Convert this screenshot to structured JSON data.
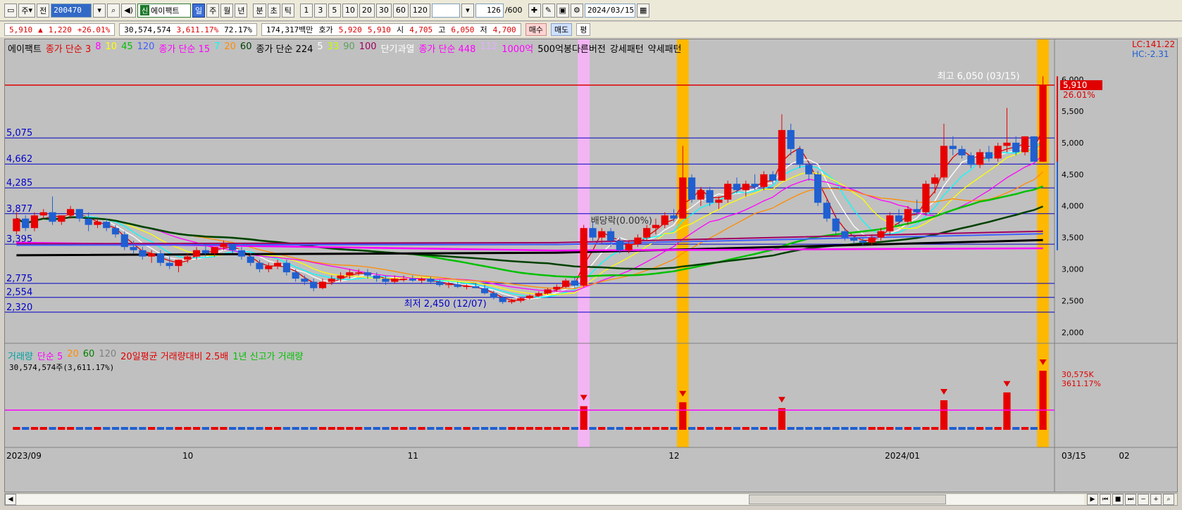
{
  "toolbar": {
    "period_label": "주",
    "prev_label": "전",
    "stock_code": "200470",
    "stock_badge": "신",
    "stock_name": "에이팩트",
    "periods": [
      "일",
      "주",
      "월",
      "년",
      "분",
      "초",
      "틱"
    ],
    "numbers": [
      "1",
      "3",
      "5",
      "10",
      "20",
      "30",
      "60",
      "120"
    ],
    "count": "126",
    "count_total": "/600",
    "date": "2024/03/15"
  },
  "price_info": {
    "price": "5,910",
    "change_arrow": "▲",
    "change": "1,220",
    "change_pct": "+26.01%",
    "volume": "30,574,574",
    "volume_pct": "3,611.17%",
    "turnover_pct": "72.17%",
    "amount": "174,317백만",
    "quote_label": "호가",
    "ask": "5,920",
    "bid": "5,910",
    "open_label": "시",
    "open": "4,705",
    "high_label": "고",
    "high": "6,050",
    "low_label": "저",
    "low": "4,700",
    "buy_label": "매수",
    "sell_label": "매도",
    "avg_label": "평"
  },
  "legend_price": [
    {
      "text": "에이팩트",
      "color": "#000000"
    },
    {
      "text": "종가 단순 3",
      "color": "#e00000"
    },
    {
      "text": "8",
      "color": "#ff00ff"
    },
    {
      "text": "10",
      "color": "#ffff00"
    },
    {
      "text": "45",
      "color": "#00c000"
    },
    {
      "text": "120",
      "color": "#4060ff"
    },
    {
      "text": "종가 단순 15",
      "color": "#ff00ff"
    },
    {
      "text": "7",
      "color": "#00ffff"
    },
    {
      "text": "20",
      "color": "#ff8c00"
    },
    {
      "text": "60",
      "color": "#004000"
    },
    {
      "text": "종가 단순 224",
      "color": "#000000"
    },
    {
      "text": "5",
      "color": "#ffffff"
    },
    {
      "text": "33",
      "color": "#c0ff00"
    },
    {
      "text": "90",
      "color": "#60a060"
    },
    {
      "text": "100",
      "color": "#a00060"
    },
    {
      "text": "단기과열",
      "color": "#ffffff"
    },
    {
      "text": "종가 단순 448",
      "color": "#ff00ff"
    },
    {
      "text": "112",
      "color": "#e0b0ff"
    },
    {
      "text": "1000억",
      "color": "#ff00ff"
    },
    {
      "text": "500억봉다른버전",
      "color": "#000000"
    },
    {
      "text": "강세패턴",
      "color": "#000000"
    },
    {
      "text": "약세패턴",
      "color": "#000000"
    }
  ],
  "legend_volume": [
    {
      "text": "거래량",
      "color": "#00a0a0"
    },
    {
      "text": "단순 5",
      "color": "#ff00ff"
    },
    {
      "text": "20",
      "color": "#ff8c00"
    },
    {
      "text": "60",
      "color": "#008000"
    },
    {
      "text": "120",
      "color": "#808080"
    },
    {
      "text": "20일평균 거래량대비 2.5배",
      "color": "#e00000"
    },
    {
      "text": "1년 신고가 거래량",
      "color": "#00c000"
    }
  ],
  "volume_readout": "30,574,574주(3,611.17%)",
  "right_labels": {
    "lc": "LC:141.22",
    "hc": "HC:-2.31",
    "price_tag": "5,910",
    "pct_tag": "26.01%",
    "vol_tag": "30,575K",
    "vol_pct_tag": "3611.17%"
  },
  "annotations": {
    "high_note": "최고 6,050 (03/15)",
    "low_note": "최저 2,450 (12/07)",
    "dividend_note": "배당락(0.00%)"
  },
  "colors": {
    "up": "#e80000",
    "down": "#1f5fd0",
    "highlight_orange": "#ffb800",
    "highlight_pink": "#ffb0ff"
  },
  "chart_data": {
    "type": "candlestick",
    "y_axis_ticks": [
      6000,
      5500,
      5000,
      4500,
      4000,
      3500,
      3000,
      2500,
      2000
    ],
    "ylim": [
      1850,
      6300
    ],
    "x_axis_labels": [
      "2023/09",
      "10",
      "11",
      "12",
      "2024/01",
      "02",
      "03",
      "03/15"
    ],
    "horizontal_levels": [
      5075,
      4662,
      4285,
      3877,
      3395,
      2775,
      2554,
      2320
    ],
    "candles": [
      [
        3600,
        3900,
        3550,
        3800
      ],
      [
        3800,
        3850,
        3600,
        3650
      ],
      [
        3650,
        3900,
        3600,
        3850
      ],
      [
        3850,
        3950,
        3800,
        3900
      ],
      [
        3900,
        4150,
        3700,
        3750
      ],
      [
        3750,
        3850,
        3700,
        3850
      ],
      [
        3850,
        4000,
        3800,
        3950
      ],
      [
        3950,
        3950,
        3750,
        3800
      ],
      [
        3800,
        3900,
        3600,
        3700
      ],
      [
        3700,
        3800,
        3650,
        3750
      ],
      [
        3750,
        3800,
        3600,
        3650
      ],
      [
        3650,
        3700,
        3500,
        3550
      ],
      [
        3550,
        3600,
        3300,
        3350
      ],
      [
        3350,
        3450,
        3250,
        3300
      ],
      [
        3300,
        3350,
        3150,
        3200
      ],
      [
        3200,
        3300,
        3100,
        3250
      ],
      [
        3250,
        3300,
        3050,
        3100
      ],
      [
        3100,
        3200,
        3000,
        3050
      ],
      [
        3050,
        3150,
        2950,
        3150
      ],
      [
        3150,
        3250,
        3100,
        3200
      ],
      [
        3200,
        3350,
        3150,
        3300
      ],
      [
        3300,
        3400,
        3200,
        3250
      ],
      [
        3250,
        3350,
        3200,
        3350
      ],
      [
        3350,
        3450,
        3300,
        3400
      ],
      [
        3400,
        3400,
        3250,
        3300
      ],
      [
        3300,
        3350,
        3150,
        3200
      ],
      [
        3200,
        3250,
        3050,
        3100
      ],
      [
        3100,
        3150,
        2950,
        3000
      ],
      [
        3000,
        3100,
        2950,
        3050
      ],
      [
        3050,
        3150,
        3000,
        3100
      ],
      [
        3100,
        3150,
        2900,
        2950
      ],
      [
        2950,
        3000,
        2800,
        2850
      ],
      [
        2850,
        2900,
        2750,
        2800
      ],
      [
        2800,
        2850,
        2650,
        2700
      ],
      [
        2700,
        2850,
        2680,
        2800
      ],
      [
        2800,
        2900,
        2750,
        2850
      ],
      [
        2850,
        2950,
        2800,
        2900
      ],
      [
        2900,
        3000,
        2850,
        2950
      ],
      [
        2950,
        3000,
        2900,
        2950
      ],
      [
        2950,
        3000,
        2850,
        2900
      ],
      [
        2900,
        2950,
        2800,
        2850
      ],
      [
        2850,
        2900,
        2750,
        2800
      ],
      [
        2800,
        2900,
        2780,
        2850
      ],
      [
        2850,
        2900,
        2800,
        2850
      ],
      [
        2850,
        2900,
        2800,
        2820
      ],
      [
        2820,
        2870,
        2780,
        2850
      ],
      [
        2850,
        2880,
        2780,
        2800
      ],
      [
        2800,
        2830,
        2720,
        2750
      ],
      [
        2750,
        2800,
        2700,
        2760
      ],
      [
        2760,
        2800,
        2700,
        2720
      ],
      [
        2720,
        2760,
        2680,
        2730
      ],
      [
        2730,
        2780,
        2700,
        2700
      ],
      [
        2700,
        2750,
        2600,
        2620
      ],
      [
        2620,
        2660,
        2520,
        2550
      ],
      [
        2550,
        2580,
        2450,
        2480
      ],
      [
        2480,
        2530,
        2450,
        2500
      ],
      [
        2500,
        2560,
        2470,
        2540
      ],
      [
        2540,
        2600,
        2520,
        2580
      ],
      [
        2580,
        2650,
        2560,
        2620
      ],
      [
        2620,
        2700,
        2600,
        2680
      ],
      [
        2680,
        2760,
        2640,
        2720
      ],
      [
        2720,
        2850,
        2700,
        2820
      ],
      [
        2820,
        2880,
        2700,
        2740
      ],
      [
        2740,
        3700,
        2720,
        3650
      ],
      [
        3650,
        3750,
        3450,
        3500
      ],
      [
        3500,
        3650,
        3400,
        3600
      ],
      [
        3600,
        3650,
        3350,
        3450
      ],
      [
        3450,
        3500,
        3250,
        3300
      ],
      [
        3300,
        3450,
        3250,
        3400
      ],
      [
        3400,
        3550,
        3350,
        3500
      ],
      [
        3500,
        3700,
        3450,
        3650
      ],
      [
        3650,
        3800,
        3550,
        3700
      ],
      [
        3700,
        3900,
        3650,
        3850
      ],
      [
        3850,
        3950,
        3750,
        3800
      ],
      [
        3800,
        4950,
        3800,
        4450
      ],
      [
        4450,
        4500,
        4050,
        4100
      ],
      [
        4100,
        4300,
        4000,
        4250
      ],
      [
        4250,
        4300,
        4000,
        4050
      ],
      [
        4050,
        4150,
        3950,
        4100
      ],
      [
        4100,
        4400,
        4050,
        4350
      ],
      [
        4350,
        4450,
        4200,
        4250
      ],
      [
        4250,
        4400,
        4150,
        4350
      ],
      [
        4350,
        4500,
        4250,
        4300
      ],
      [
        4300,
        4550,
        4250,
        4500
      ],
      [
        4500,
        4550,
        4350,
        4400
      ],
      [
        4400,
        5450,
        4400,
        5200
      ],
      [
        5200,
        5300,
        4800,
        4900
      ],
      [
        4900,
        4950,
        4600,
        4650
      ],
      [
        4650,
        4700,
        4400,
        4500
      ],
      [
        4500,
        4550,
        4000,
        4050
      ],
      [
        4050,
        4100,
        3750,
        3800
      ],
      [
        3800,
        3850,
        3550,
        3600
      ],
      [
        3600,
        3650,
        3450,
        3500
      ],
      [
        3500,
        3550,
        3400,
        3450
      ],
      [
        3450,
        3500,
        3380,
        3420
      ],
      [
        3420,
        3550,
        3380,
        3500
      ],
      [
        3500,
        3650,
        3450,
        3600
      ],
      [
        3600,
        3900,
        3550,
        3850
      ],
      [
        3850,
        3950,
        3700,
        3750
      ],
      [
        3750,
        4000,
        3700,
        3950
      ],
      [
        3950,
        4100,
        3850,
        3900
      ],
      [
        3900,
        4400,
        3850,
        4350
      ],
      [
        4350,
        4500,
        4200,
        4450
      ],
      [
        4450,
        5300,
        4400,
        4950
      ],
      [
        4950,
        5100,
        4800,
        4900
      ],
      [
        4900,
        4950,
        4750,
        4800
      ],
      [
        4800,
        4850,
        4600,
        4650
      ],
      [
        4650,
        4900,
        4600,
        4850
      ],
      [
        4850,
        4950,
        4700,
        4750
      ],
      [
        4750,
        5000,
        4700,
        4950
      ],
      [
        4950,
        5550,
        4850,
        5000
      ],
      [
        5000,
        5100,
        4800,
        4850
      ],
      [
        4850,
        5100,
        4800,
        5100
      ],
      [
        5100,
        5100,
        4750,
        4700
      ],
      [
        4700,
        6050,
        4700,
        5910
      ]
    ],
    "volume_spikes": [
      {
        "index": 63,
        "value": 12
      },
      {
        "index": 74,
        "value": 14
      },
      {
        "index": 85,
        "value": 11
      },
      {
        "index": 103,
        "value": 15
      },
      {
        "index": 110,
        "value": 19
      },
      {
        "index": 114,
        "value": 30
      }
    ]
  }
}
